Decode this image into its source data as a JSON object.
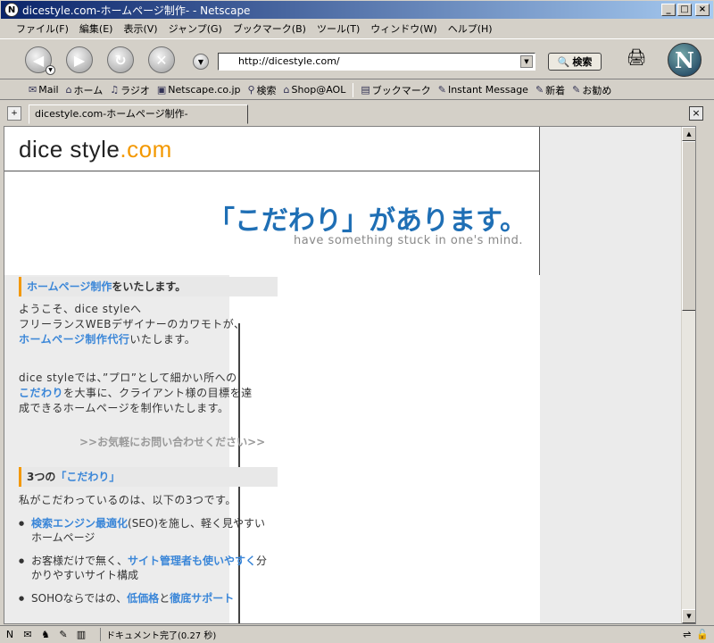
{
  "window": {
    "title": "dicestyle.com-ホームページ制作- - Netscape",
    "app_icon": "N",
    "minimize": "_",
    "maximize": "□",
    "close": "×"
  },
  "menu": [
    "ファイル(F)",
    "編集(E)",
    "表示(V)",
    "ジャンプ(G)",
    "ブックマーク(B)",
    "ツール(T)",
    "ウィンドウ(W)",
    "ヘルプ(H)"
  ],
  "nav": {
    "url": "http://dicestyle.com/",
    "search_label": "検索",
    "logo_letter": "N",
    "icons": {
      "back": "◀",
      "forward": "▶",
      "reload": "↻",
      "stop": "✕",
      "go": "▼",
      "dropdown": "▼",
      "search": "🔍",
      "print": "🖨"
    }
  },
  "personal_toolbar": [
    {
      "label": "Mail",
      "icon": "✉"
    },
    {
      "label": "ホーム",
      "icon": "⌂"
    },
    {
      "label": "ラジオ",
      "icon": "♫"
    },
    {
      "label": "Netscape.co.jp",
      "icon": "▣"
    },
    {
      "label": "検索",
      "icon": "⚲"
    },
    {
      "label": "Shop@AOL",
      "icon": "⌂"
    },
    {
      "label": "ブックマーク",
      "icon": "▤"
    },
    {
      "label": "Instant Message",
      "icon": "✎"
    },
    {
      "label": "新着",
      "icon": "✎"
    },
    {
      "label": "お勧め",
      "icon": "✎"
    }
  ],
  "tabs": {
    "active_label": "dicestyle.com-ホームページ制作-",
    "new_tab_icon": "+",
    "close_icon": "×"
  },
  "page": {
    "logo_main": "dice style",
    "logo_dot": ".com",
    "catch_jp": "「こだわり」があります。",
    "catch_en": "have something stuck in one's mind.",
    "section1": {
      "hl": "ホームページ制作",
      "rest": "をいたします。"
    },
    "intro": {
      "line1": "ようこそ、dice styleへ",
      "line2": "フリーランスWEBデザイナーのカワモトが、",
      "line3_hl": "ホームページ制作代行",
      "line3_rest": "いたします。"
    },
    "para2": {
      "line1": "dice styleでは、”プロ”として細かい所への",
      "line2_hl": "こだわり",
      "line2_rest": "を大事に、クライアント様の目標を達",
      "line3": "成できるホームページを制作いたします。"
    },
    "contact": ">>お気軽にお問い合わせください>>",
    "section2": {
      "prefix": "3つの",
      "hl": "「こだわり」"
    },
    "points_intro": "私がこだわっているのは、以下の3つです。",
    "points": [
      {
        "hl": "検索エンジン最適化",
        "rest": "(SEO)を施し、軽く見やすいホームページ"
      },
      {
        "pre": "お客様だけで無く、",
        "hl": "サイト管理者も使いやすく",
        "rest": "分かりやすいサイト構成"
      },
      {
        "pre": "SOHOならではの、",
        "hl": "低価格",
        "mid": "と",
        "hl2": "徹底サポート"
      }
    ]
  },
  "status": {
    "text": "ドキュメント完了(0.27 秒)",
    "icons": [
      "✉",
      "♞",
      "✎",
      "▥",
      "⊟"
    ]
  },
  "colors": {
    "accent_blue": "#1f6fb5",
    "link_blue": "#3a86d8",
    "orange": "#f39800"
  }
}
